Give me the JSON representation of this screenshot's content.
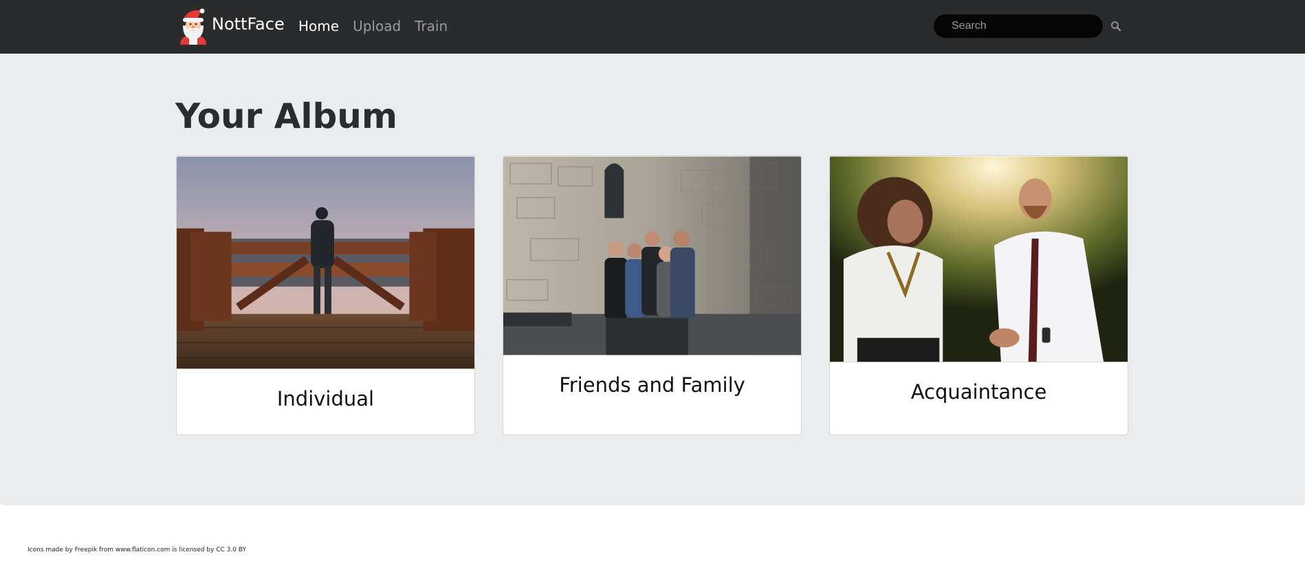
{
  "navbar": {
    "brand": "NottFace",
    "links": [
      "Home",
      "Upload",
      "Train"
    ],
    "active_link": "Home",
    "search_placeholder": "Search",
    "search_icon": "search-icon",
    "logo_icon": "santa-claus-icon"
  },
  "main": {
    "title": "Your Album",
    "cards": [
      {
        "label": "Individual",
        "image": "person standing on wooden pier at sunset"
      },
      {
        "label": "Friends and Family",
        "image": "group of friends taking a selfie by stone wall"
      },
      {
        "label": "Acquaintance",
        "image": "man and woman talking outdoors in sunlight"
      }
    ]
  },
  "footer": {
    "credit": "Icons made by Freepik from www.flaticon.com is licensed by CC 3.0 BY"
  },
  "colors": {
    "navbar_bg": "#292b2d",
    "jumbotron_bg": "#ebecee",
    "nav_active": "#ffffff",
    "nav_inactive": "#9a9b9c",
    "search_bg": "#050505"
  }
}
